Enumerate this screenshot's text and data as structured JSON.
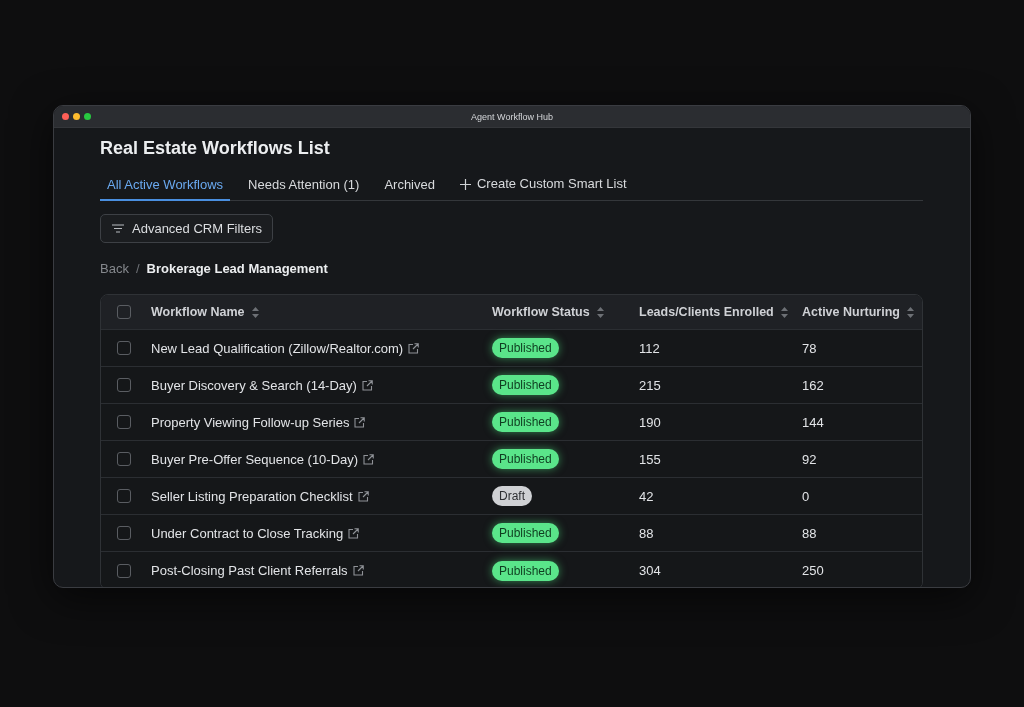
{
  "window": {
    "title": "Agent Workflow Hub"
  },
  "page": {
    "title": "Real Estate Workflows List"
  },
  "tabs": [
    {
      "label": "All Active Workflows",
      "selected": true
    },
    {
      "label": "Needs Attention (1)",
      "selected": false
    },
    {
      "label": "Archived",
      "selected": false
    }
  ],
  "create_list_button": {
    "label": "Create Custom Smart List"
  },
  "filter_button": {
    "label": "Advanced CRM Filters"
  },
  "breadcrumb": {
    "items": [
      "Back",
      "Brokerage Lead Management"
    ],
    "separator": "/"
  },
  "table": {
    "select_all": {
      "checked": false
    },
    "columns": [
      "Workflow Name",
      "Workflow Status",
      "Leads/Clients Enrolled",
      "Active Nurturing"
    ],
    "rows": [
      {
        "checked": false,
        "name": "New Lead Qualification (Zillow/Realtor.com)",
        "status": {
          "kind": "published",
          "label": "Published"
        },
        "enrolled": "112",
        "nurturing": "78"
      },
      {
        "checked": false,
        "name": "Buyer Discovery & Search (14-Day)",
        "status": {
          "kind": "published",
          "label": "Published"
        },
        "enrolled": "215",
        "nurturing": "162"
      },
      {
        "checked": false,
        "name": "Property Viewing Follow-up Series",
        "status": {
          "kind": "published",
          "label": "Published"
        },
        "enrolled": "190",
        "nurturing": "144"
      },
      {
        "checked": false,
        "name": "Buyer Pre-Offer Sequence (10-Day)",
        "status": {
          "kind": "published",
          "label": "Published"
        },
        "enrolled": "155",
        "nurturing": "92"
      },
      {
        "checked": false,
        "name": "Seller Listing Preparation Checklist",
        "status": {
          "kind": "draft",
          "label": "Draft"
        },
        "enrolled": "42",
        "nurturing": "0"
      },
      {
        "checked": false,
        "name": "Under Contract to Close Tracking",
        "status": {
          "kind": "published",
          "label": "Published"
        },
        "enrolled": "88",
        "nurturing": "88"
      },
      {
        "checked": false,
        "name": "Post-Closing Past Client Referrals",
        "status": {
          "kind": "published",
          "label": "Published"
        },
        "enrolled": "304",
        "nurturing": "250"
      }
    ]
  }
}
